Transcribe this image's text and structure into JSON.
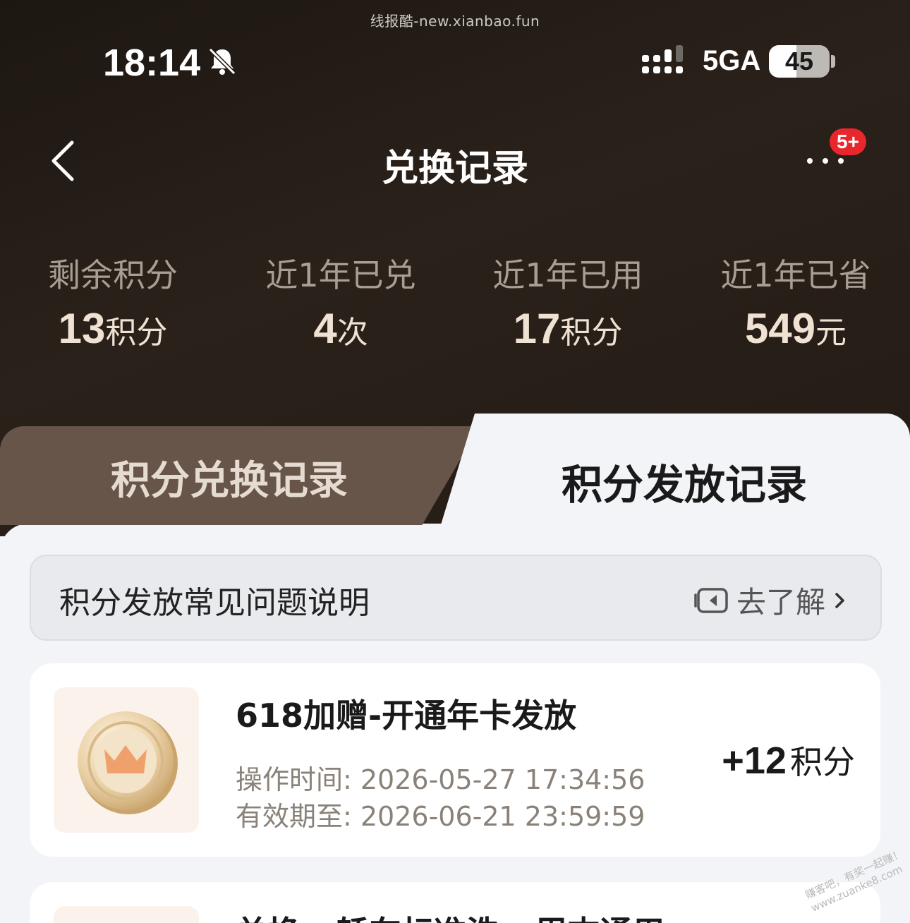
{
  "watermark_top": "线报酷-new.xianbao.fun",
  "status_bar": {
    "time": "18:14",
    "network": "5GA",
    "battery_level": 45,
    "battery_label": "45"
  },
  "nav": {
    "title": "兑换记录",
    "badge": "5+"
  },
  "stats": [
    {
      "label": "剩余积分",
      "value": "13",
      "unit": "积分"
    },
    {
      "label": "近1年已兑",
      "value": "4",
      "unit": "次"
    },
    {
      "label": "近1年已用",
      "value": "17",
      "unit": "积分"
    },
    {
      "label": "近1年已省",
      "value": "549",
      "unit": "元"
    }
  ],
  "tabs": {
    "inactive": "积分兑换记录",
    "active": "积分发放记录"
  },
  "faq": {
    "title": "积分发放常见问题说明",
    "link": "去了解"
  },
  "records": [
    {
      "title": "618加赠-开通年卡发放",
      "op_time": "操作时间: 2026-05-27 17:34:56",
      "expire": "有效期至: 2026-06-21 23:59:59",
      "points": "+12",
      "points_unit": "积分"
    },
    {
      "title": "兑换 - 轿车标准洗 - 周末通用"
    }
  ],
  "watermark_corner": {
    "line1": "赚客吧，有奖一起赚！",
    "line2": "www.zuanke8.com"
  },
  "colors": {
    "hero_bg": "#231b15",
    "stat_value": "#f0e2d2",
    "stat_label": "#a89e93",
    "tab_inactive": "#665548",
    "badge": "#e8262b"
  }
}
